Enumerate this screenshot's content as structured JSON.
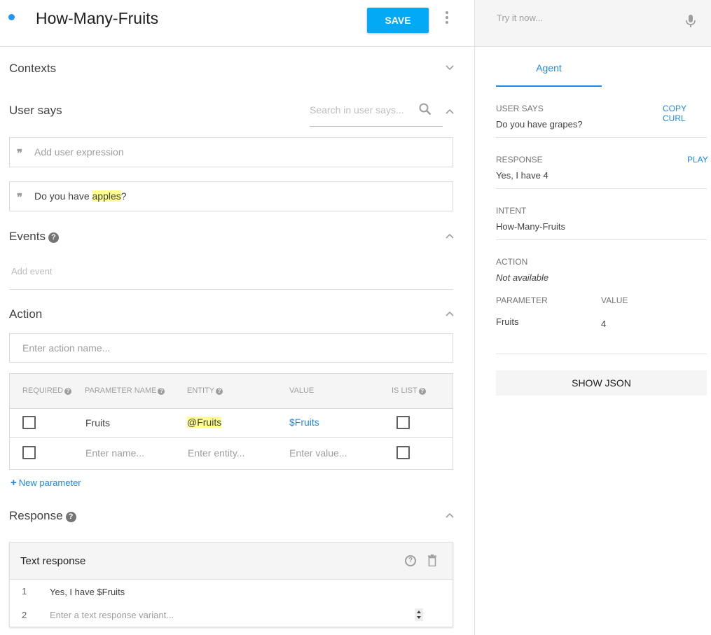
{
  "header": {
    "title": "How-Many-Fruits",
    "save_label": "SAVE"
  },
  "sections": {
    "contexts": "Contexts",
    "user_says": "User says",
    "events": "Events",
    "action": "Action",
    "response": "Response"
  },
  "user_says": {
    "search_placeholder": "Search in user says...",
    "add_placeholder": "Add user expression",
    "expression": {
      "before": "Do you have ",
      "entity": "apples",
      "after": "?"
    }
  },
  "events": {
    "add_placeholder": "Add event"
  },
  "action": {
    "name_placeholder": "Enter action name...",
    "columns": [
      "REQUIRED",
      "PARAMETER NAME",
      "ENTITY",
      "VALUE",
      "IS LIST"
    ],
    "rows": [
      {
        "name": "Fruits",
        "entity": "@Fruits",
        "value": "$Fruits"
      }
    ],
    "new_row": {
      "name_placeholder": "Enter name...",
      "entity_placeholder": "Enter entity...",
      "value_placeholder": "Enter value..."
    },
    "new_parameter_label": "New parameter"
  },
  "response": {
    "card_title": "Text response",
    "lines": [
      {
        "num": "1",
        "text": "Yes, I have $Fruits"
      }
    ],
    "variant_num": "2",
    "variant_placeholder": "Enter a text response variant..."
  },
  "test_panel": {
    "try_placeholder": "Try it now...",
    "tab": "Agent",
    "user_says_label": "USER SAYS",
    "copy_curl": "COPY CURL",
    "user_says_value": "Do you have grapes?",
    "response_label": "RESPONSE",
    "play": "PLAY",
    "response_value": "Yes, I have 4",
    "intent_label": "INTENT",
    "intent_value": "How-Many-Fruits",
    "action_label": "ACTION",
    "action_value": "Not available",
    "param_header": "PARAMETER",
    "value_header": "VALUE",
    "param_name": "Fruits",
    "param_value": "4",
    "show_json": "SHOW JSON"
  },
  "colors": {
    "accent": "#03a9f4",
    "link": "#1e88e5",
    "highlight": "#ffff8d"
  }
}
